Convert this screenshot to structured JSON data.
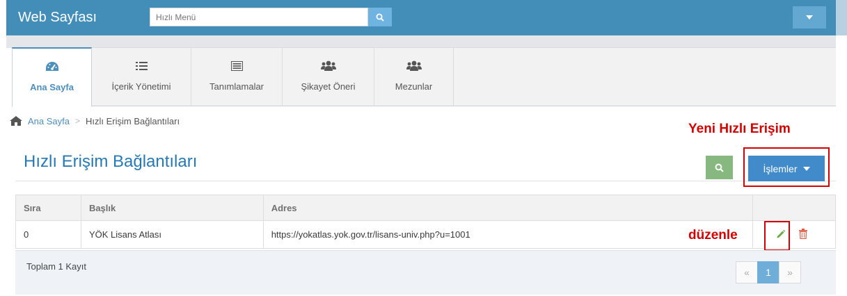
{
  "navbar": {
    "brand": "Web Sayfası",
    "search_placeholder": "Hızlı Menü",
    "color": "#438eb9"
  },
  "tabs": [
    {
      "label": "Ana Sayfa",
      "icon": "dashboard-icon",
      "active": true
    },
    {
      "label": "İçerik Yönetimi",
      "icon": "list-icon",
      "active": false
    },
    {
      "label": "Tanımlamalar",
      "icon": "list-alt-icon",
      "active": false
    },
    {
      "label": "Şikayet Öneri",
      "icon": "group-icon",
      "active": false
    },
    {
      "label": "Mezunlar",
      "icon": "group-icon",
      "active": false
    }
  ],
  "breadcrumb": {
    "home": "Ana Sayfa",
    "current": "Hızlı Erişim Bağlantıları"
  },
  "annotations": {
    "new_quick_access": "Yeni Hızlı Erişim",
    "edit": "düzenle",
    "color": "#d40000"
  },
  "page": {
    "title": "Hızlı Erişim Bağlantıları",
    "actions_label": "İşlemler"
  },
  "table": {
    "headers": [
      "Sıra",
      "Başlık",
      "Adres",
      ""
    ],
    "rows": [
      {
        "sira": "0",
        "baslik": "YÖK Lisans Atlası",
        "adres": "https://yokatlas.yok.gov.tr/lisans-univ.php?u=1001"
      }
    ]
  },
  "footer": {
    "total": "Toplam 1 Kayıt",
    "pagination": {
      "prev": "«",
      "current": "1",
      "next": "»"
    }
  }
}
